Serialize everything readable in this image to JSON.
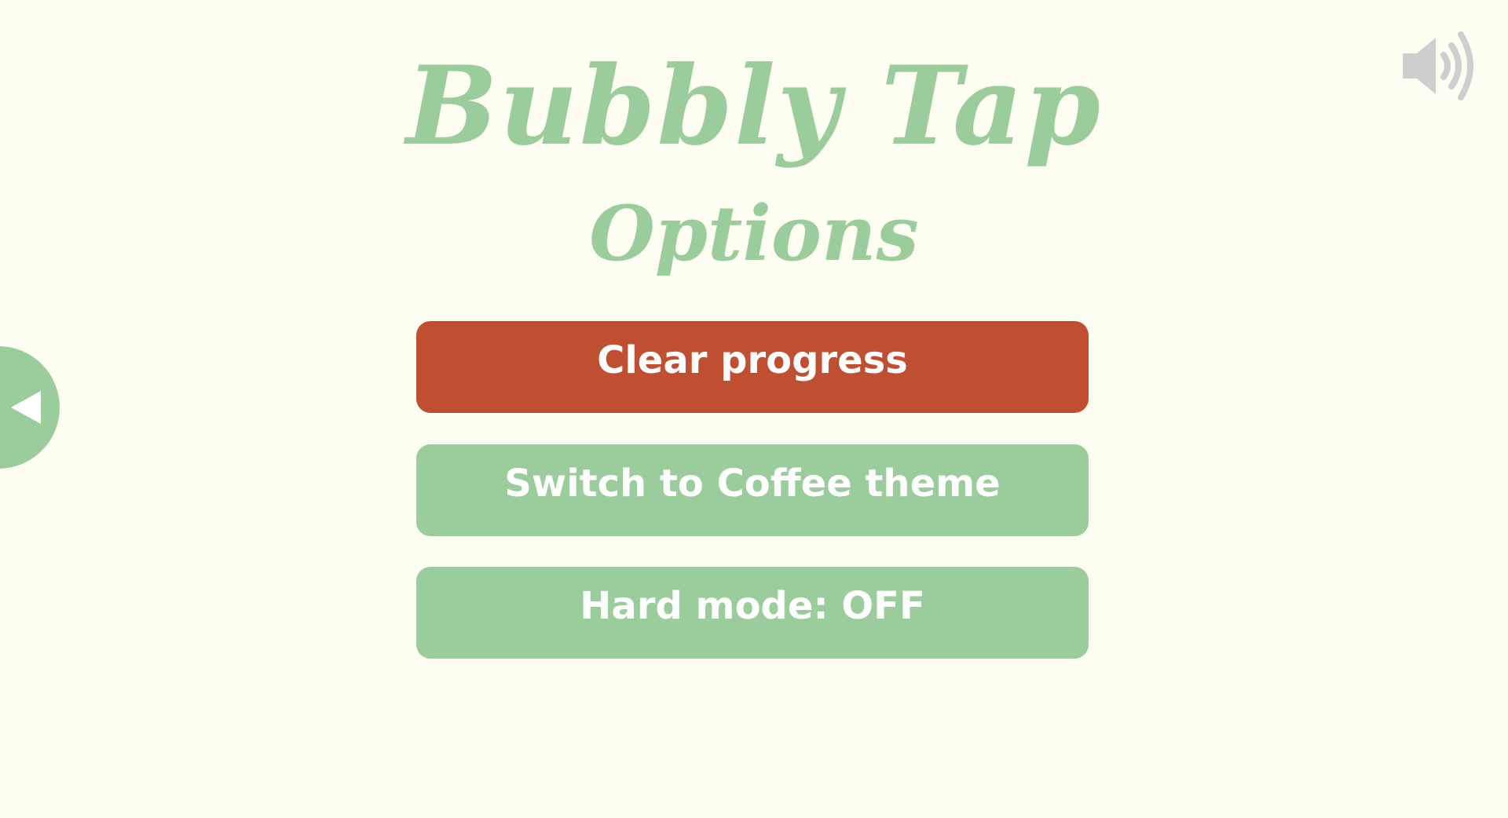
{
  "game": {
    "title": "Bubbly Tap",
    "screen_title": "Options"
  },
  "menu": {
    "clear_progress_label": "Clear progress",
    "switch_theme_label": "Switch to Coffee theme",
    "hard_mode_label": "Hard mode: OFF"
  },
  "icons": {
    "back": "back-arrow-icon",
    "sound": "speaker-volume-icon"
  },
  "colors": {
    "background": "#fdfdf1",
    "accent_green": "#9bcc9b",
    "danger_red": "#c04f31",
    "sound_icon": "#cfcfcf"
  }
}
